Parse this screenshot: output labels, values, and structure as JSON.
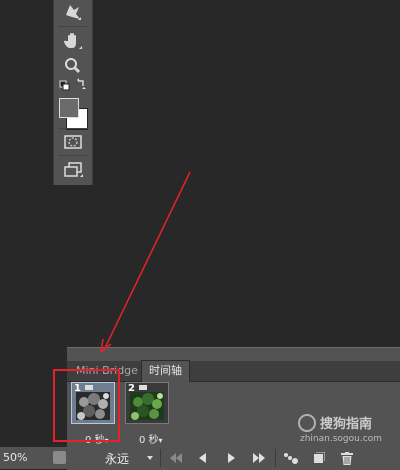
{
  "panel": {
    "tabs": [
      {
        "label": "Mini Bridge"
      },
      {
        "label": "时间轴"
      }
    ],
    "frames": [
      {
        "number": "1",
        "delay": "0 秒"
      },
      {
        "number": "2",
        "delay": "0 秒"
      }
    ],
    "loop_option": "永远"
  },
  "status": {
    "zoom": "50%"
  },
  "watermark": {
    "brand": "搜狗指南",
    "site": "zhinan.sogou.com"
  },
  "tools": [
    "puppet-warp-icon",
    "hand-icon",
    "zoom-icon",
    "default-colors-icon",
    "swap-colors-icon",
    "foreground-color-swatch",
    "background-color-swatch",
    "quick-mask-icon",
    "screen-mode-icon"
  ],
  "colors": {
    "annotation": "#e5222a",
    "foreground": "#6b6b6b",
    "background": "#ffffff"
  }
}
